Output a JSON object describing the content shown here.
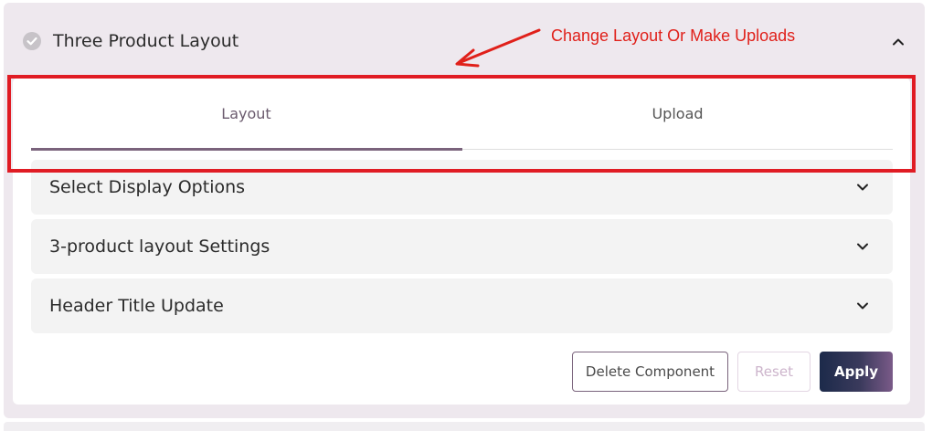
{
  "header": {
    "title": "Three Product Layout"
  },
  "annotation": {
    "text": "Change Layout Or Make Uploads",
    "color": "#e0201a"
  },
  "tabs": [
    {
      "label": "Layout",
      "active": true
    },
    {
      "label": "Upload",
      "active": false
    }
  ],
  "accordions": [
    {
      "label": "Select Display Options"
    },
    {
      "label": "3-product layout Settings"
    },
    {
      "label": "Header Title Update"
    }
  ],
  "actions": {
    "delete_label": "Delete Component",
    "reset_label": "Reset",
    "apply_label": "Apply"
  },
  "colors": {
    "accent": "#7a637c",
    "highlight": "#e01c24",
    "apply_bg": "#1c2a4a"
  }
}
